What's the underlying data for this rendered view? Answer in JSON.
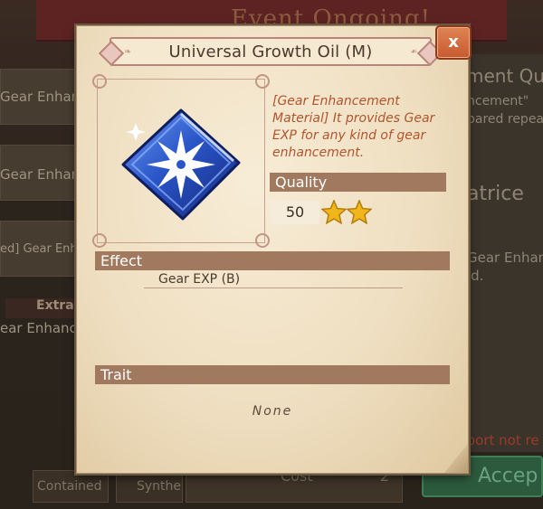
{
  "background": {
    "banner_title": "Event Ongoing!",
    "left_rows": [
      "Gear Enhanc",
      "Gear Enhan",
      "ed] Gear Enhan",
      "ear Enhancem"
    ],
    "extra_label": "Extra",
    "right_texts": [
      "ment Qu",
      "ncement\"",
      "pared repea",
      "atrice",
      "Gear Enhan",
      "id.",
      "oort not re"
    ],
    "accept_label": "Accep",
    "bottom_buttons": [
      "Contained",
      "Synthe"
    ],
    "cost_label": "Cost",
    "cost_value": "2"
  },
  "dialog": {
    "title": "Universal Growth Oil (M)",
    "close_label": "x",
    "description": "[Gear Enhancement Material] It provides Gear EXP for any kind of gear enhancement.",
    "quality_label": "Quality",
    "quality_value": "50",
    "stars": 2,
    "effect_label": "Effect",
    "effect_value": "Gear EXP (B)",
    "trait_label": "Trait",
    "trait_value": "None"
  },
  "icons": {
    "item": "blue-gem-snowflake-icon",
    "star": "gold-star-icon",
    "close": "close-icon"
  },
  "colors": {
    "label_bar": "#a0795e",
    "description_text": "#b1542e",
    "close_button": "#c75a2f",
    "gem_blue": "#2a55c8",
    "star_gold": "#f2b61d"
  }
}
